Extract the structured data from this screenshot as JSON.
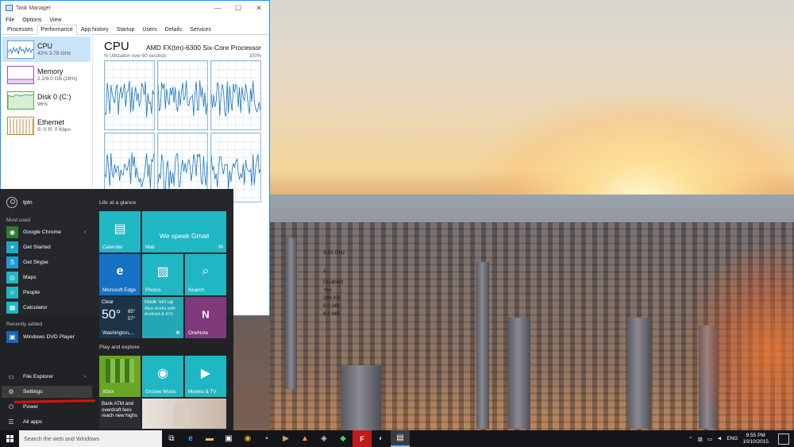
{
  "task_manager": {
    "title": "Task Manager",
    "menu": [
      "File",
      "Options",
      "View"
    ],
    "tabs": [
      "Processes",
      "Performance",
      "App history",
      "Startup",
      "Users",
      "Details",
      "Services"
    ],
    "active_tab": "Performance",
    "resources": [
      {
        "name": "CPU",
        "value": "42%  3.78 GHz"
      },
      {
        "name": "Memory",
        "value": "2.2/8.0 GB (28%)"
      },
      {
        "name": "Disk 0 (C:)",
        "value": "96%"
      },
      {
        "name": "Ethernet",
        "value": "S: 0  R: 0 Kbps"
      }
    ],
    "cpu": {
      "title": "CPU",
      "model": "AMD FX(tm)-6300 Six-Core Processor",
      "utilization_label": "% Utilization over 60 seconds",
      "max_label": "100%",
      "partial_stats": [
        "3.50 GHz",
        "1",
        "Disabled",
        "Yes",
        "288 KB",
        "6.0 MB",
        "8.0 MB"
      ]
    }
  },
  "start_menu": {
    "user": "tptn",
    "most_used_label": "Most used",
    "most_used": [
      {
        "label": "Google Chrome",
        "color": "#2e7d32",
        "icon": "chrome-icon",
        "glyph": "◉",
        "has_arrow": true
      },
      {
        "label": "Get Started",
        "color": "#1fa7c9",
        "icon": "lightbulb-icon",
        "glyph": "✦",
        "has_arrow": false
      },
      {
        "label": "Get Skype",
        "color": "#1e9ad6",
        "icon": "skype-icon",
        "glyph": "S",
        "has_arrow": false
      },
      {
        "label": "Maps",
        "color": "#1fb7c4",
        "icon": "maps-icon",
        "glyph": "◎",
        "has_arrow": false
      },
      {
        "label": "People",
        "color": "#1fb7c4",
        "icon": "people-icon",
        "glyph": "☺",
        "has_arrow": false
      },
      {
        "label": "Calculator",
        "color": "#1fb7c4",
        "icon": "calculator-icon",
        "glyph": "▦",
        "has_arrow": false
      }
    ],
    "recently_added_label": "Recently added",
    "recently_added": [
      {
        "label": "Windows DVD Player",
        "color": "#1b66b1",
        "icon": "dvd-icon",
        "glyph": "▣"
      }
    ],
    "system": [
      {
        "label": "File Explorer",
        "icon": "folder-icon",
        "glyph": "▭",
        "has_arrow": true
      },
      {
        "label": "Settings",
        "icon": "gear-icon",
        "glyph": "⚙",
        "has_arrow": false
      },
      {
        "label": "Power",
        "icon": "power-icon",
        "glyph": "⏻",
        "has_arrow": false
      },
      {
        "label": "All apps",
        "icon": "list-icon",
        "glyph": "☰",
        "has_arrow": false
      }
    ],
    "life_label": "Life at a glance",
    "play_label": "Play and explore",
    "tiles": {
      "calendar": "Calendar",
      "mail_big": "We speak Gmail",
      "mail": "Mail",
      "edge": "Microsoft Edge",
      "photos": "Photos",
      "search": "Search",
      "weather_cond": "Clear",
      "weather_temp": "50°",
      "weather_hi": "65°",
      "weather_lo": "57°",
      "weather_city": "Washington,...",
      "xbox_line1": "Hook 'em up",
      "xbox_line2": "Also works with Android & iOS",
      "onenote": "OneNote",
      "xbox": "Xbox",
      "groove": "Groove Music",
      "movies": "Movies & TV",
      "news": "Bank ATM and overdraft fees reach new highs"
    }
  },
  "taskbar": {
    "search_placeholder": "Search the web and Windows",
    "language": "ENG",
    "time": "9:55 PM",
    "date": "10/10/2015"
  }
}
